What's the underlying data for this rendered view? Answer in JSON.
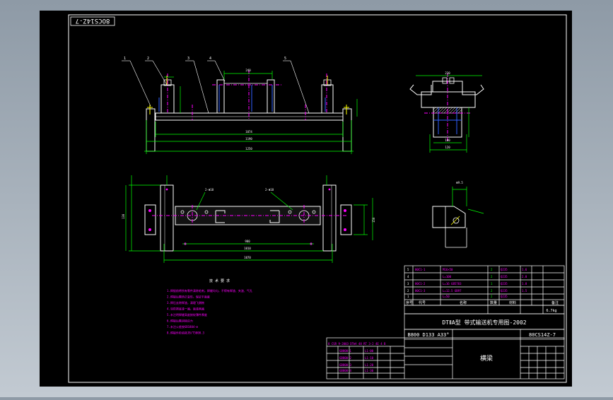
{
  "drawing": {
    "code_box": "8OCS14Z-7",
    "notes": {
      "title": "技 术 要 求",
      "lines": [
        "1.焊接前将所有零件清除毛刺，焊缝均匀，不得有焊渣、夹渣、气孔",
        "2.焊接后需矫正变形，保证平面度",
        "3.焊后去除焊渣，清理飞溅物",
        "4.涂防锈底漆一遍，面漆两遍",
        "5.未注明焊缝高度按较薄件厚度",
        "6.焊接后需消除应力",
        "7.未注公差按GB1804-m",
        "8.焊接件检验按JB/T5000.3"
      ]
    },
    "title_block": {
      "title": "DTⅡA型 带式输送机专用图-2002",
      "code_mid": "B800 D133 A33°",
      "code_right": "80CS14Z-7",
      "part_name": "横梁",
      "parts_header": [
        "序号",
        "代号",
        "名称",
        "数量",
        "材料",
        "备注"
      ],
      "mass": "6.7kg"
    }
  }
}
